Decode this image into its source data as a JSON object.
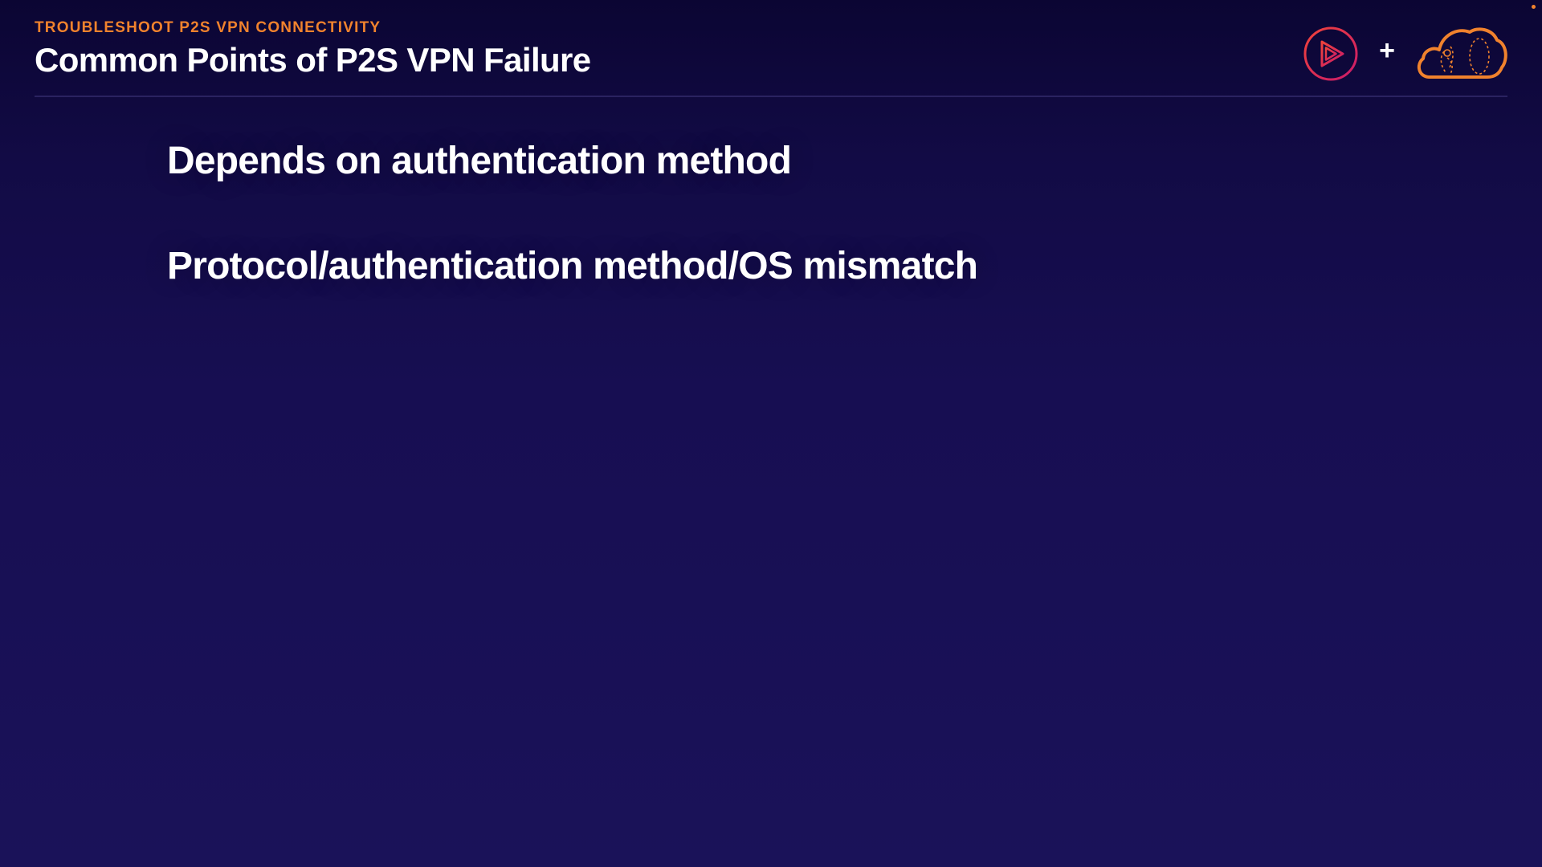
{
  "header": {
    "eyebrow": "TROUBLESHOOT P2S VPN CONNECTIVITY",
    "title": "Common Points of P2S VPN Failure",
    "plus": "+"
  },
  "bullets": [
    "Depends on authentication method",
    "Protocol/authentication method/OS mismatch"
  ],
  "icons": {
    "play_logo": "play-logo-icon",
    "cloud_logo": "cloud-logo-icon"
  },
  "colors": {
    "background_top": "#0b0533",
    "background_bottom": "#1a1259",
    "accent_orange": "#f0822d",
    "play_logo_pink": "#e0245e",
    "text": "#ffffff"
  }
}
